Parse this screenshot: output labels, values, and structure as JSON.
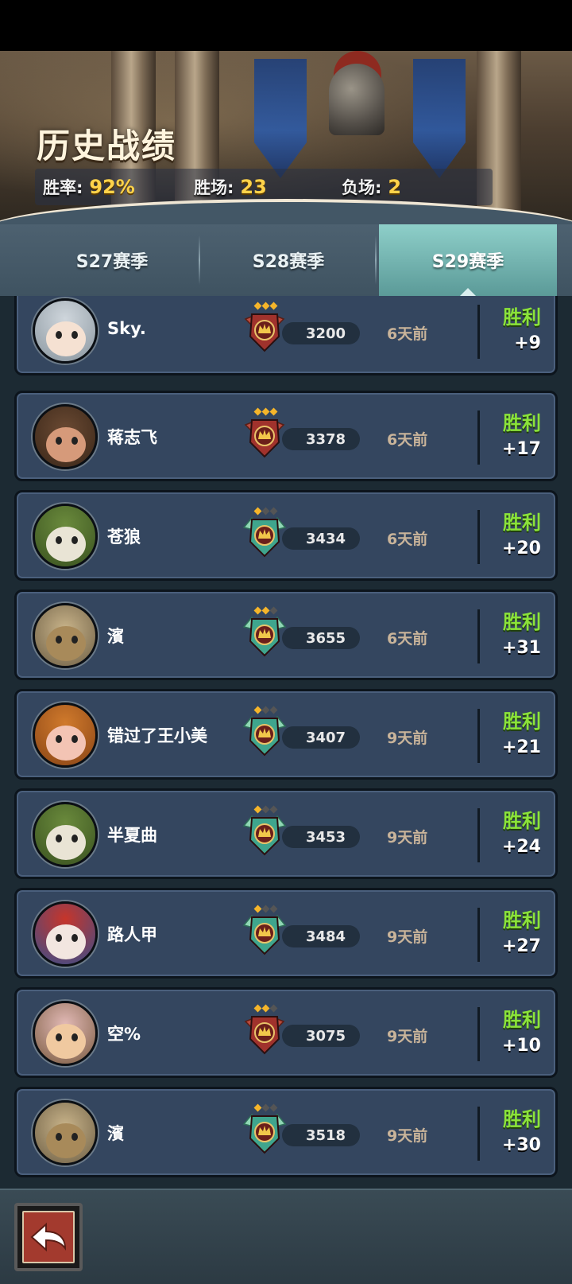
{
  "header": {
    "title": "历史战绩",
    "stats": [
      {
        "label": "胜率:",
        "value": "92%"
      },
      {
        "label": "胜场:",
        "value": "23"
      },
      {
        "label": "负场:",
        "value": "2"
      }
    ]
  },
  "tabs": [
    {
      "label": "S27赛季",
      "active": false
    },
    {
      "label": "S28赛季",
      "active": false
    },
    {
      "label": "S29赛季",
      "active": true
    }
  ],
  "matches": [
    {
      "name": "Sky.",
      "score": "3200",
      "time": "6天前",
      "result": "胜利",
      "delta": "+9",
      "badge": "bronze",
      "stars": 3,
      "avatar": "silver-hair"
    },
    {
      "name": "蒋志飞",
      "score": "3378",
      "time": "6天前",
      "result": "胜利",
      "delta": "+17",
      "badge": "bronze",
      "stars": 3,
      "avatar": "brown-beard"
    },
    {
      "name": "苍狼",
      "score": "3434",
      "time": "6天前",
      "result": "胜利",
      "delta": "+20",
      "badge": "silver",
      "stars": 1,
      "avatar": "raccoon"
    },
    {
      "name": "濱",
      "score": "3655",
      "time": "6天前",
      "result": "胜利",
      "delta": "+31",
      "badge": "silver",
      "stars": 2,
      "avatar": "masked"
    },
    {
      "name": "错过了王小美",
      "score": "3407",
      "time": "9天前",
      "result": "胜利",
      "delta": "+21",
      "badge": "silver",
      "stars": 1,
      "avatar": "pumpkin"
    },
    {
      "name": "半夏曲",
      "score": "3453",
      "time": "9天前",
      "result": "胜利",
      "delta": "+24",
      "badge": "silver",
      "stars": 1,
      "avatar": "raccoon"
    },
    {
      "name": "路人甲",
      "score": "3484",
      "time": "9天前",
      "result": "胜利",
      "delta": "+27",
      "badge": "silver",
      "stars": 1,
      "avatar": "red-hat"
    },
    {
      "name": "空%",
      "score": "3075",
      "time": "9天前",
      "result": "胜利",
      "delta": "+10",
      "badge": "bronze",
      "stars": 2,
      "avatar": "goggles"
    },
    {
      "name": "濱",
      "score": "3518",
      "time": "9天前",
      "result": "胜利",
      "delta": "+30",
      "badge": "silver",
      "stars": 1,
      "avatar": "masked"
    }
  ],
  "footer": {
    "back_icon": "back-arrow-icon"
  },
  "colors": {
    "win": "#8be33a",
    "score_gold": "#ffd34a",
    "row_bg": "#34465f",
    "active_tab": "#7bbab6"
  }
}
